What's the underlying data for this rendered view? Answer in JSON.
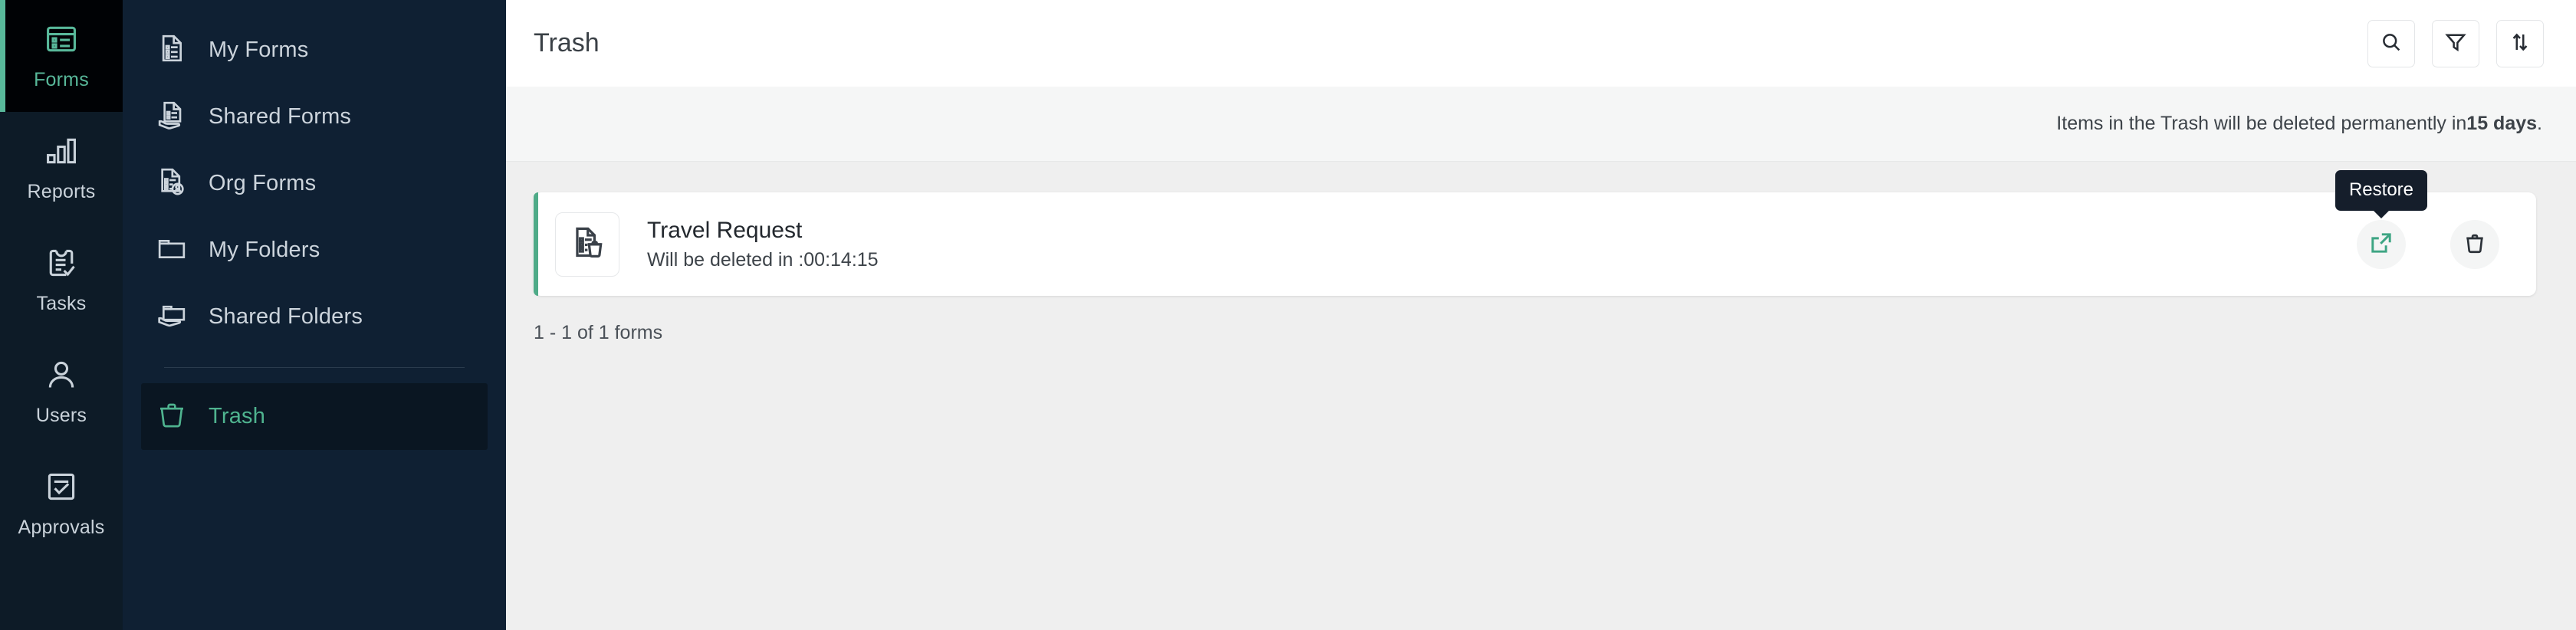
{
  "rail": {
    "items": [
      {
        "label": "Forms",
        "icon": "forms-icon",
        "active": true
      },
      {
        "label": "Reports",
        "icon": "reports-icon",
        "active": false
      },
      {
        "label": "Tasks",
        "icon": "tasks-icon",
        "active": false
      },
      {
        "label": "Users",
        "icon": "users-icon",
        "active": false
      },
      {
        "label": "Approvals",
        "icon": "approvals-icon",
        "active": false
      }
    ]
  },
  "sidebar": {
    "items": [
      {
        "label": "My Forms",
        "icon": "document-list-icon",
        "active": false
      },
      {
        "label": "Shared Forms",
        "icon": "shared-document-icon",
        "active": false
      },
      {
        "label": "Org Forms",
        "icon": "document-user-icon",
        "active": false
      },
      {
        "label": "My Folders",
        "icon": "folder-icon",
        "active": false
      },
      {
        "label": "Shared Folders",
        "icon": "shared-folder-icon",
        "active": false
      },
      {
        "label": "Trash",
        "icon": "trash-icon",
        "active": true
      }
    ]
  },
  "header": {
    "title": "Trash",
    "actions": [
      {
        "name": "search-icon",
        "label": "Search"
      },
      {
        "name": "filter-icon",
        "label": "Filter"
      },
      {
        "name": "sort-icon",
        "label": "Sort"
      }
    ]
  },
  "notice": {
    "text_before": "Items in the Trash will be deleted permanently in ",
    "highlight": "15 days",
    "text_after": "."
  },
  "list": {
    "items": [
      {
        "title": "Travel Request",
        "subtitle": "Will be deleted in :00:14:15",
        "icon": "document-trash-icon",
        "restore_tooltip": "Restore",
        "restore_icon": "restore-icon",
        "delete_icon": "delete-icon"
      }
    ]
  },
  "pagination": {
    "summary": "1 - 1 of 1 forms"
  },
  "colors": {
    "accent_green": "#4fab88",
    "rail_bg": "#0d1b27",
    "nav_bg": "#0f2033",
    "active_rail_bg": "#000205",
    "tooltip_bg": "#151e2b",
    "content_bg": "#efefef",
    "notice_bg": "#f5f6f6"
  }
}
